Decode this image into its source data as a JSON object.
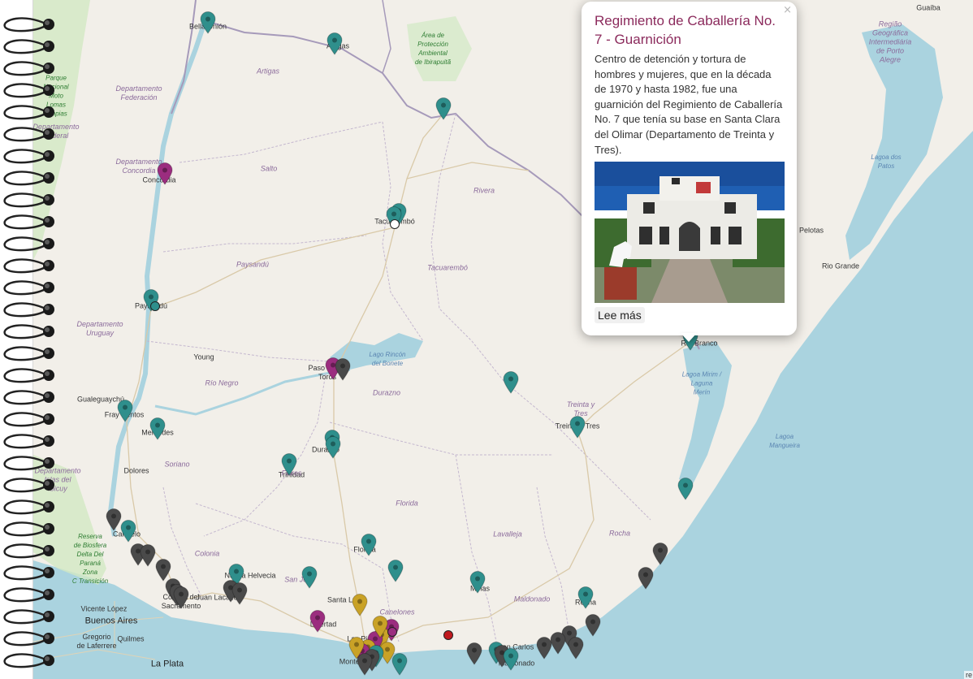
{
  "colors": {
    "teal_marker": "#2f8f8c",
    "magenta_marker": "#9b2d7f",
    "gray_marker": "#4a4a4a",
    "gold_marker": "#c9a227",
    "red_marker": "#c0191e",
    "popup_title": "#8b2a5c",
    "water": "#aad3df",
    "land": "#f2efe9"
  },
  "map": {
    "labels": {
      "bella_union": "Bella Unión",
      "artigas_city": "Artigas",
      "area_proteccion": "Área de\nProtección\nAmbiental\nde Ibirapuitã",
      "artigas_dept": "Artigas",
      "monte_caseros_park": "Parque\nNacional\nMoto\nLomas\nLimpias",
      "depto_federacion": "Departamento\nFederación",
      "depto_feliciano": "Departamento\nFederal",
      "depto_concordia": "Departamento\nConcordia",
      "concordia": "Concordia",
      "salto_dept": "Salto",
      "rivera_dept": "Rivera",
      "tacuarembo_city": "Tacuarembó",
      "tacuarembo_dept": "Tacuarembó",
      "paysandu_dept": "Paysandú",
      "paysandu_city": "Paysandú",
      "depto_uruguay": "Departamento\nUruguay",
      "young": "Young",
      "lago_rincon": "Lago Rincón\ndel Bonete",
      "paso_toros": "Paso de los\nToros",
      "rio_negro_dept": "Río Negro",
      "durazno_dept": "Durazno",
      "gualeguaychu": "Gualeguaychú",
      "fray_bentos": "Fray Bentos",
      "mercedes": "Mercedes",
      "dolores": "Dolores",
      "soriano_dept": "Soriano",
      "depto_islas": "Departamento\nIslas del\nIbicuy",
      "durazno_city": "Durazno",
      "trinidad": "Trinidad",
      "flores_dept": "Flores",
      "florida_dept": "Florida",
      "lavalleja_dept": "Lavalleja",
      "treinta_tres_dept": "Treinta y\nTres",
      "treinta_tres_city": "Treinta y Tres",
      "rocha_dept": "Rocha",
      "carmelo": "Carmelo",
      "reserva_biosfera": "Reserva\nde Biosfera\nDelta Del\nParaná\nZona\nC Transición",
      "colonia_dept": "Colonia",
      "nueva_helvecia": "Nueva Helvecia",
      "san_jose_dept": "San José",
      "florida_city": "Florida",
      "santa_lucia": "Santa Lucía",
      "canelones_dept": "Canelones",
      "maldonado_dept": "Maldonado",
      "rocha_city": "Rocha",
      "juan_lacaze": "Juan Lacaze",
      "colonia_sacramento": "Colonia del\nSacramento",
      "minas": "Minas",
      "vicente_lopez": "Vicente López",
      "buenos_aires": "Buenos Aires",
      "gregorio": "Gregorio\nde Laferrere",
      "quilmes": "Quilmes",
      "la_plata": "La Plata",
      "libertad": "Libertad",
      "las_piedras": "Las Piedras",
      "montevideo": "Montevideo",
      "san_carlos": "San Carlos",
      "maldonado_city": "Maldonado",
      "rio_branco": "Río Branco",
      "lagoa_mirim": "Lagoa Mirim /\nLaguna\nMerín",
      "lagoa_mangueira": "Lagoa\nMangueira",
      "pelotas": "Pelotas",
      "rio_grande": "Rio Grande",
      "lagoa_patos": "Lagoa dos\nPatos",
      "regiao_porto_alegre": "Região\nGeográfica\nIntermediária\nde Porto\nAlegre",
      "guaiba": "Guaíba"
    },
    "attribution": "re"
  },
  "popup": {
    "title": "Regimiento de Caballería No. 7 - Guarnición",
    "description": "Centro de detención y tortura de hombres y mujeres, que en la década de 1970 y hasta 1982, fue una guarnición del Regimiento de Caballería No. 7 que tenía su base en Santa Clara del Olimar (Departamento de Treinta y Tres).",
    "button": "Lee más",
    "close": "×"
  }
}
